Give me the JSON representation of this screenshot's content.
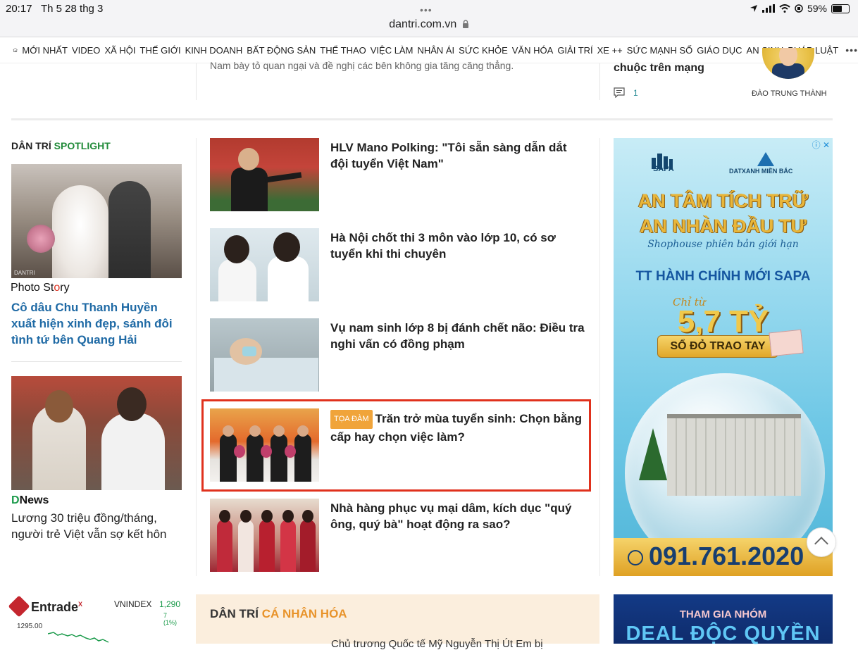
{
  "status_bar": {
    "time": "20:17",
    "date": "Th 5 28 thg 3",
    "url": "dantri.com.vn",
    "battery": "59%"
  },
  "nav": {
    "items": [
      "MỚI NHẤT",
      "VIDEO",
      "XÃ HỘI",
      "THẾ GIỚI",
      "KINH DOANH",
      "BẤT ĐỘNG SẢN",
      "THỂ THAO",
      "VIỆC LÀM",
      "NHÂN ÁI",
      "SỨC KHỎE",
      "VĂN HÓA",
      "GIẢI TRÍ",
      "XE ++",
      "SỨC MẠNH SỐ",
      "GIÁO DỤC",
      "AN SINH",
      "PHÁP LUẬT"
    ]
  },
  "top": {
    "snippet": "Nam bày tỏ quan ngại và đề nghị các bên không gia tăng căng thẳng.",
    "title_fragment": "chuộc trên mạng",
    "comment_count": "1",
    "author": "ĐÀO TRUNG THÀNH"
  },
  "spotlight": {
    "heading_part1": "DÂN TRÍ",
    "heading_part2": "SPOTLIGHT",
    "photo_story_a": "Photo St",
    "photo_story_dot": "o",
    "photo_story_b": "ry",
    "story1_title": "Cô dâu Chu Thanh Huyền xuất hiện xinh đẹp, sánh đôi tình tứ bên Quang Hải",
    "dnews_d": "D",
    "dnews_rest": "News",
    "story2_title": "Lương 30 triệu đồng/tháng, người trẻ Việt vẫn sợ kết hôn",
    "img1_watermark": "DANTRI"
  },
  "articles": [
    {
      "title": "HLV Mano Polking: \"Tôi sẵn sàng dẫn dắt đội tuyển Việt Nam\""
    },
    {
      "title": "Hà Nội chốt thi 3 môn vào lớp 10, có sơ tuyển khi thi chuyên"
    },
    {
      "title": "Vụ nam sinh lớp 8 bị đánh chết não: Điều tra nghi vấn có đồng phạm"
    },
    {
      "badge": "TỌA ĐÀM",
      "title": "Trăn trở mùa tuyển sinh: Chọn bằng cấp hay chọn việc làm?"
    },
    {
      "title": "Nhà hàng phục vụ mại dâm, kích dục \"quý ông, quý bà\" hoạt động ra sao?"
    }
  ],
  "ad1": {
    "brand1": "SAPA",
    "brand2": "DATXANH MIỀN BẮC",
    "headline1": "AN TÂM TÍCH TRỮ",
    "headline2": "AN NHÀN ĐẦU TƯ",
    "script": "Shophouse phiên bản giới hạn",
    "sub": "TT HÀNH CHÍNH MỚI SAPA",
    "chi_tu": "Chỉ từ",
    "price": "5,7 TỶ",
    "banner": "SỔ ĐỎ TRAO TAY",
    "phone": "091.761.2020",
    "close": "ⓘ ✕"
  },
  "entrade": {
    "logo": "Entrade",
    "logo_sup": "X",
    "index_label": "VNINDEX",
    "index_value": "1,290",
    "index_change": "7 (1%)",
    "y_tick": "1295.00"
  },
  "personal": {
    "heading_part1": "DÂN TRÍ",
    "heading_part2": "CÁ NHÂN HÓA",
    "cut_text": "Chủ trương Quốc tế Mỹ Nguyễn Thị Út Em bị"
  },
  "ad2": {
    "line1": "THAM GIA NHÓM",
    "line2": "DEAL ĐỘC QUYỀN"
  },
  "icons": {
    "home": "home-icon",
    "comment": "comment-icon",
    "more": "more-dots-icon",
    "scroll_top": "chevron-up-icon"
  },
  "colors": {
    "link_blue": "#1f6aa5",
    "spotlight_green": "#228b3a",
    "highlight_red": "#e0311d",
    "badge_orange": "#f0a43a",
    "personal_bg": "#fbeedd"
  }
}
